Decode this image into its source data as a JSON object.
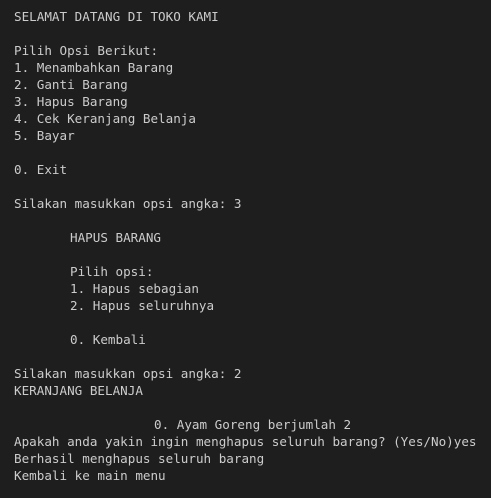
{
  "terminal": {
    "lines": [
      {
        "text": "SELAMAT DATANG DI TOKO KAMI",
        "indent": 0
      },
      {
        "text": "",
        "indent": 0
      },
      {
        "text": "Pilih Opsi Berikut:",
        "indent": 0
      },
      {
        "text": "1. Menambahkan Barang",
        "indent": 0
      },
      {
        "text": "2. Ganti Barang",
        "indent": 0
      },
      {
        "text": "3. Hapus Barang",
        "indent": 0
      },
      {
        "text": "4. Cek Keranjang Belanja",
        "indent": 0
      },
      {
        "text": "5. Bayar",
        "indent": 0
      },
      {
        "text": "",
        "indent": 0
      },
      {
        "text": "0. Exit",
        "indent": 0
      },
      {
        "text": "",
        "indent": 0
      },
      {
        "text": "Silakan masukkan opsi angka: 3",
        "indent": 0
      },
      {
        "text": "",
        "indent": 0
      },
      {
        "text": "HAPUS BARANG",
        "indent": 1
      },
      {
        "text": "",
        "indent": 0
      },
      {
        "text": "Pilih opsi:",
        "indent": 1
      },
      {
        "text": "1. Hapus sebagian",
        "indent": 1
      },
      {
        "text": "2. Hapus seluruhnya",
        "indent": 1
      },
      {
        "text": "",
        "indent": 0
      },
      {
        "text": "0. Kembali",
        "indent": 1
      },
      {
        "text": "",
        "indent": 0
      },
      {
        "text": "Silakan masukkan opsi angka: 2",
        "indent": 0
      },
      {
        "text": "KERANJANG BELANJA",
        "indent": 0
      },
      {
        "text": "",
        "indent": 0
      },
      {
        "text": "0. Ayam Goreng berjumlah 2",
        "indent": 2
      },
      {
        "text": "Apakah anda yakin ingin menghapus seluruh barang? (Yes/No)yes",
        "indent": 0
      },
      {
        "text": "Berhasil menghapus seluruh barang",
        "indent": 0
      },
      {
        "text": "Kembali ke main menu",
        "indent": 0
      }
    ]
  },
  "colors": {
    "background": "#1e1e1e",
    "foreground": "#cccccc"
  }
}
